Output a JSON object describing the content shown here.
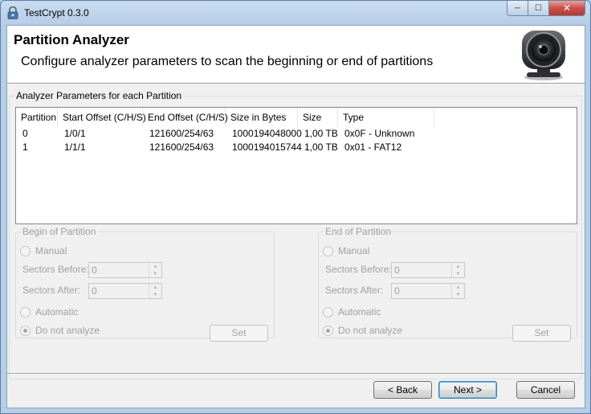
{
  "window": {
    "title": "TestCrypt 0.3.0",
    "minimize_glyph": "─",
    "maximize_glyph": "☐",
    "close_glyph": "✕"
  },
  "header": {
    "title": "Partition Analyzer",
    "subtitle": "Configure analyzer parameters to scan the beginning or end of partitions",
    "logo_icon": "webcam-icon"
  },
  "params_group": {
    "label": "Analyzer Parameters for each Partition",
    "columns": [
      "Partition",
      "Start Offset (C/H/S)",
      "End Offset (C/H/S)",
      "Size in Bytes",
      "Size",
      "Type"
    ],
    "rows": [
      [
        "0",
        "1/0/1",
        "121600/254/63",
        "1000194048000",
        "1,00 TB",
        "0x0F - Unknown"
      ],
      [
        "1",
        "1/1/1",
        "121600/254/63",
        "1000194015744",
        "1,00 TB",
        "0x01 - FAT12"
      ]
    ]
  },
  "begin_group": {
    "label": "Begin of Partition",
    "manual_label": "Manual",
    "sectors_before_label": "Sectors Before:",
    "sectors_before_value": "0",
    "sectors_after_label": "Sectors After:",
    "sectors_after_value": "0",
    "automatic_label": "Automatic",
    "do_not_analyze_label": "Do not analyze",
    "set_label": "Set"
  },
  "end_group": {
    "label": "End of Partition",
    "manual_label": "Manual",
    "sectors_before_label": "Sectors Before:",
    "sectors_before_value": "0",
    "sectors_after_label": "Sectors After:",
    "sectors_after_value": "0",
    "automatic_label": "Automatic",
    "do_not_analyze_label": "Do not analyze",
    "set_label": "Set"
  },
  "footer": {
    "back_label": "< Back",
    "next_label": "Next >",
    "cancel_label": "Cancel"
  },
  "colors": {
    "window_frame": "#b9d1ea",
    "disabled_text": "#a0a0a0",
    "close_button": "#c75050"
  }
}
